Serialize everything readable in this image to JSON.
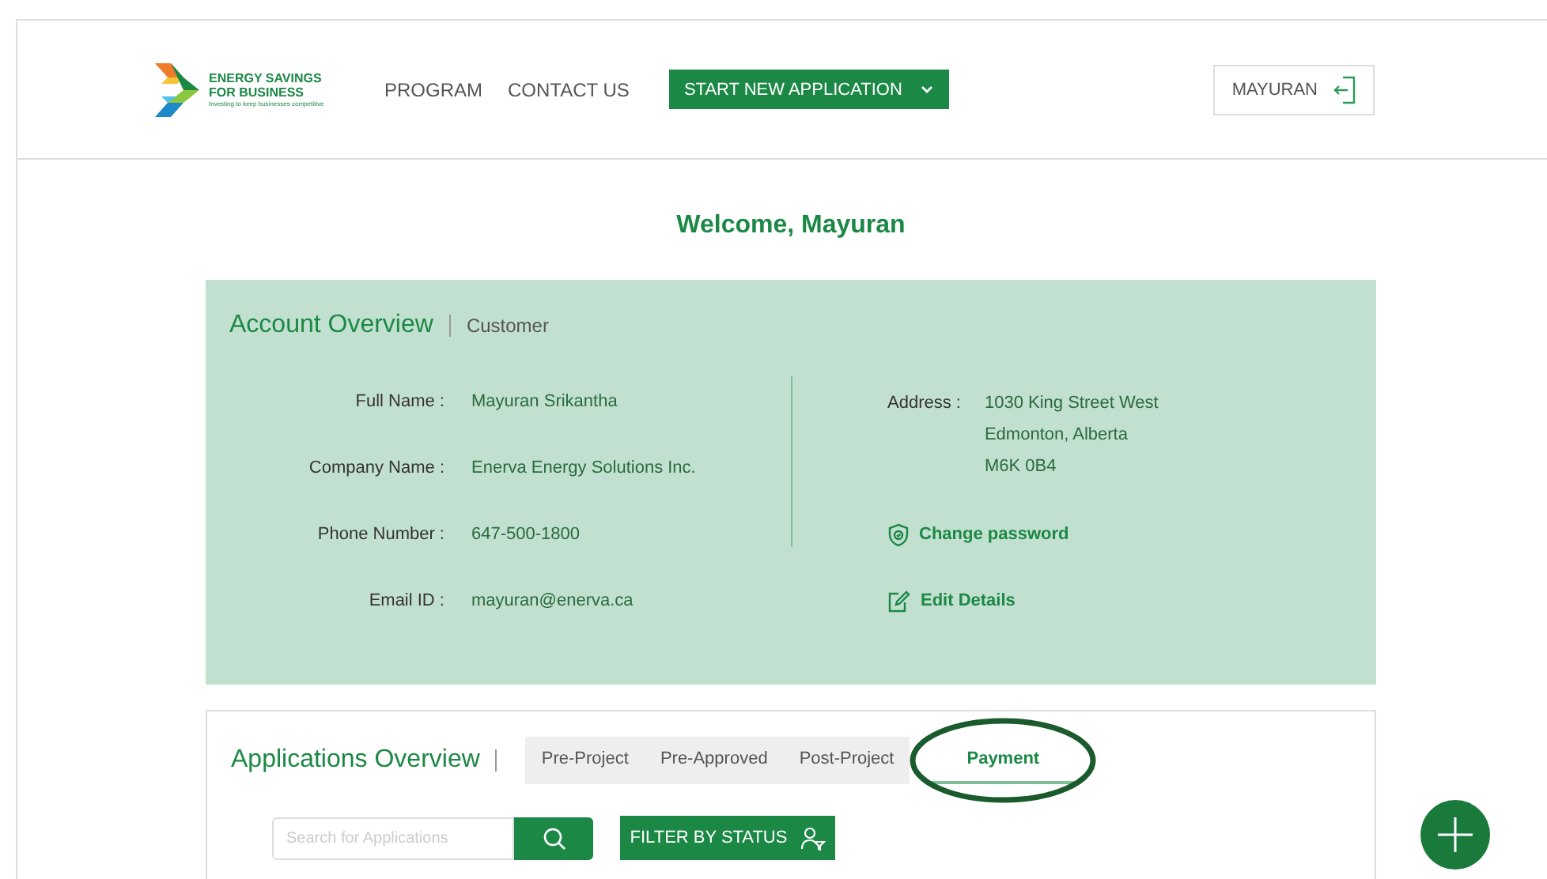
{
  "header": {
    "logo": {
      "line1": "ENERGY SAVINGS",
      "line2": "FOR BUSINESS",
      "tagline": "Investing to keep businesses competitive"
    },
    "nav": [
      {
        "label": "PROGRAM"
      },
      {
        "label": "CONTACT US"
      }
    ],
    "start_button": "START NEW APPLICATION",
    "user_button": "MAYURAN"
  },
  "welcome": "Welcome, Mayuran",
  "account": {
    "title": "Account Overview",
    "role": "Customer",
    "fields": [
      {
        "label": "Full Name :",
        "value": "Mayuran Srikantha"
      },
      {
        "label": "Company Name :",
        "value": "Enerva Energy Solutions Inc."
      },
      {
        "label": "Phone Number :",
        "value": "647-500-1800"
      },
      {
        "label": "Email ID :",
        "value": "mayuran@enerva.ca"
      }
    ],
    "address": {
      "label": "Address :",
      "lines": [
        "1030 King Street West",
        "Edmonton, Alberta",
        "M6K 0B4"
      ]
    },
    "links": [
      {
        "kind": "password",
        "label": "Change password"
      },
      {
        "kind": "edit",
        "label": "Edit Details"
      }
    ]
  },
  "applications": {
    "title": "Applications Overview",
    "tabs": [
      {
        "label": "Pre-Project",
        "selected": false,
        "circled": false
      },
      {
        "label": "Pre-Approved",
        "selected": false,
        "circled": false
      },
      {
        "label": "Post-Project",
        "selected": false,
        "circled": false
      },
      {
        "label": "Payment",
        "selected": true,
        "circled": true
      }
    ],
    "search": {
      "placeholder": "Search for Applications"
    },
    "filter_button": "FILTER BY STATUS"
  }
}
